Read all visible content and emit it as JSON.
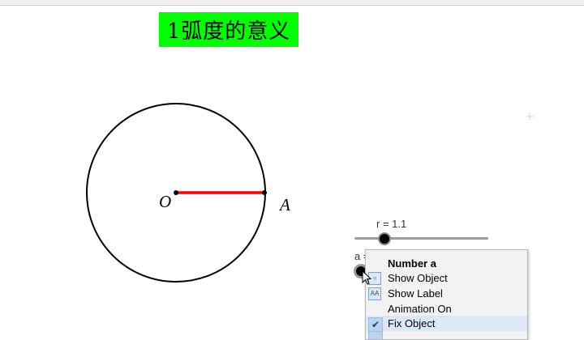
{
  "title": "1弧度的意义",
  "geometry": {
    "center_label": "O",
    "point_label": "A"
  },
  "slider_r": {
    "label": "r = 1.1",
    "value": 1.1
  },
  "slider_a": {
    "label": "a ="
  },
  "context_menu": {
    "title": "Number a",
    "items": [
      {
        "label": "Show Object",
        "icon": "show-object-icon",
        "checked": false
      },
      {
        "label": "Show Label",
        "icon": "show-label-icon",
        "checked": false
      },
      {
        "label": "Animation On",
        "icon": "",
        "checked": false
      },
      {
        "label": "Fix Object",
        "icon": "check-icon",
        "checked": true
      }
    ]
  },
  "colors": {
    "title_bg": "#00ff00",
    "radius_line": "#ff0000",
    "circle": "#000000"
  }
}
